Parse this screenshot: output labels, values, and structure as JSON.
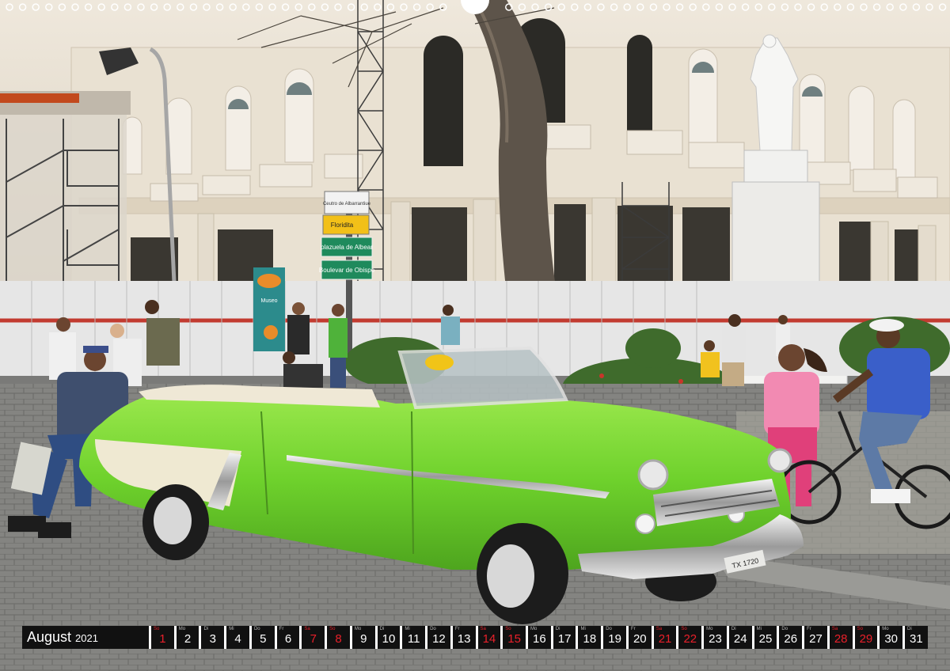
{
  "calendar": {
    "month": "August",
    "year": "2021",
    "days": [
      {
        "wd": "So",
        "num": "1",
        "red": true
      },
      {
        "wd": "Mo",
        "num": "2",
        "red": false
      },
      {
        "wd": "Di",
        "num": "3",
        "red": false
      },
      {
        "wd": "Mi",
        "num": "4",
        "red": false
      },
      {
        "wd": "Do",
        "num": "5",
        "red": false
      },
      {
        "wd": "Fr",
        "num": "6",
        "red": false
      },
      {
        "wd": "Sa",
        "num": "7",
        "red": true
      },
      {
        "wd": "So",
        "num": "8",
        "red": true
      },
      {
        "wd": "Mo",
        "num": "9",
        "red": false
      },
      {
        "wd": "Di",
        "num": "10",
        "red": false
      },
      {
        "wd": "Mi",
        "num": "11",
        "red": false
      },
      {
        "wd": "Do",
        "num": "12",
        "red": false
      },
      {
        "wd": "Fr",
        "num": "13",
        "red": false
      },
      {
        "wd": "Sa",
        "num": "14",
        "red": true
      },
      {
        "wd": "So",
        "num": "15",
        "red": true
      },
      {
        "wd": "Mo",
        "num": "16",
        "red": false
      },
      {
        "wd": "Di",
        "num": "17",
        "red": false
      },
      {
        "wd": "Mi",
        "num": "18",
        "red": false
      },
      {
        "wd": "Do",
        "num": "19",
        "red": false
      },
      {
        "wd": "Fr",
        "num": "20",
        "red": false
      },
      {
        "wd": "Sa",
        "num": "21",
        "red": true
      },
      {
        "wd": "So",
        "num": "22",
        "red": true
      },
      {
        "wd": "Mo",
        "num": "23",
        "red": false
      },
      {
        "wd": "Di",
        "num": "24",
        "red": false
      },
      {
        "wd": "Mi",
        "num": "25",
        "red": false
      },
      {
        "wd": "Do",
        "num": "26",
        "red": false
      },
      {
        "wd": "Fr",
        "num": "27",
        "red": false
      },
      {
        "wd": "Sa",
        "num": "28",
        "red": true
      },
      {
        "wd": "So",
        "num": "29",
        "red": true
      },
      {
        "wd": "Mo",
        "num": "30",
        "red": false
      },
      {
        "wd": "Di",
        "num": "31",
        "red": false
      }
    ]
  },
  "signs": {
    "top": "Ceutro de Albarrantiue",
    "yellow": "Floridita",
    "green1": "plazuela de Albear",
    "green2": "Boulevar de Obispo"
  },
  "poster": {
    "text": "Museo"
  },
  "plate": {
    "text": "TX 1720"
  },
  "colors": {
    "car_green": "#7ed63a",
    "sky_building": "#e6ddcc",
    "weekend_red": "#e8202a"
  }
}
